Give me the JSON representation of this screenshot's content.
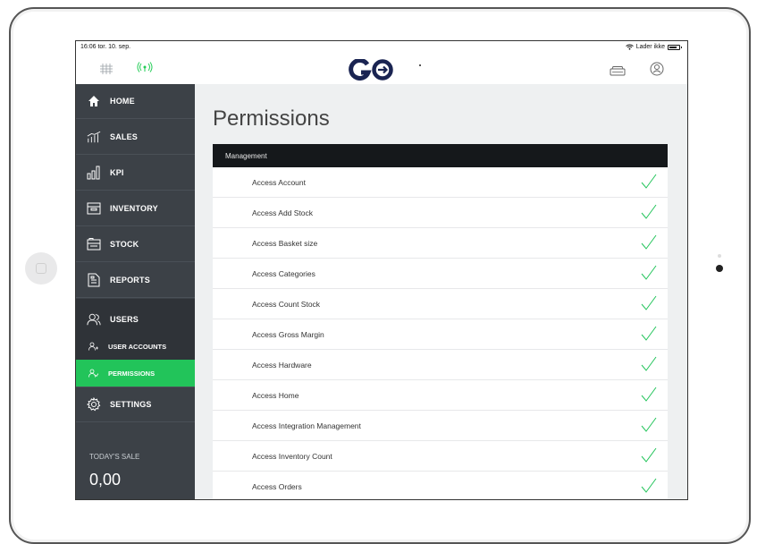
{
  "status_bar": {
    "time_date": "16:06  tor. 10. sep.",
    "charging": "Lader ikke"
  },
  "top_bar": {
    "logo_text": "GO"
  },
  "colors": {
    "sidebar_bg": "#3c4147",
    "accent_green": "#22c45a",
    "header_dark": "#15181b",
    "logo_navy": "#1a2452"
  },
  "sidebar": {
    "items": [
      {
        "label": "HOME",
        "icon": "home-icon"
      },
      {
        "label": "SALES",
        "icon": "sales-chart-icon"
      },
      {
        "label": "KPI",
        "icon": "kpi-bars-icon"
      },
      {
        "label": "INVENTORY",
        "icon": "inventory-box-icon"
      },
      {
        "label": "STOCK",
        "icon": "stock-box-icon"
      },
      {
        "label": "REPORTS",
        "icon": "report-icon"
      },
      {
        "label": "USERS",
        "icon": "users-icon"
      }
    ],
    "sub_items": [
      {
        "label": "USER ACCOUNTS",
        "icon": "user-account-icon"
      },
      {
        "label": "PERMISSIONS",
        "icon": "permissions-icon"
      }
    ],
    "settings_label": "SETTINGS",
    "today_sale_label": "TODAY'S SALE",
    "today_sale_value": "0,00"
  },
  "main": {
    "title": "Permissions",
    "section": "Management",
    "permissions": [
      {
        "label": "Access Account",
        "granted": true
      },
      {
        "label": "Access Add Stock",
        "granted": true
      },
      {
        "label": "Access Basket size",
        "granted": true
      },
      {
        "label": "Access Categories",
        "granted": true
      },
      {
        "label": "Access Count Stock",
        "granted": true
      },
      {
        "label": "Access Gross Margin",
        "granted": true
      },
      {
        "label": "Access Hardware",
        "granted": true
      },
      {
        "label": "Access Home",
        "granted": true
      },
      {
        "label": "Access Integration Management",
        "granted": true
      },
      {
        "label": "Access Inventory Count",
        "granted": true
      },
      {
        "label": "Access Orders",
        "granted": true
      }
    ]
  }
}
